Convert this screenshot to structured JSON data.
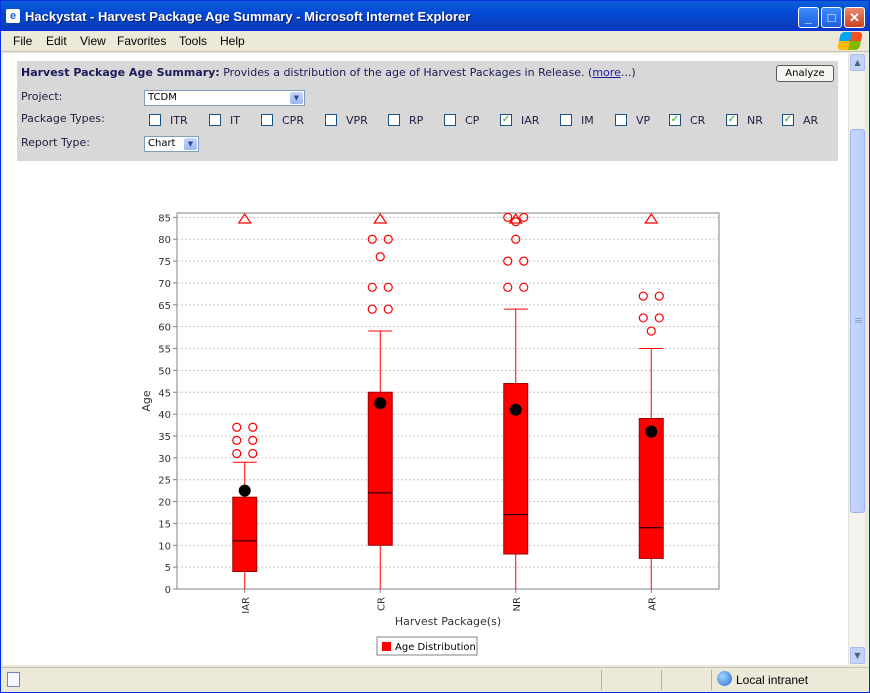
{
  "window": {
    "title": "Hackystat - Harvest Package Age Summary - Microsoft Internet Explorer",
    "buttons": {
      "minimize": "_",
      "maximize": "□",
      "close": "✕"
    }
  },
  "menubar": {
    "items": [
      "File",
      "Edit",
      "View",
      "Favorites",
      "Tools",
      "Help"
    ]
  },
  "form": {
    "heading_bold": "Harvest Package Age Summary:",
    "heading_text": "Provides a distribution of the age of Harvest Packages in Release. (",
    "more_link": "more",
    "heading_tail": "...)",
    "analyze_label": "Analyze",
    "project_label": "Project:",
    "project_value": "TCDM",
    "package_types_label": "Package Types:",
    "report_type_label": "Report Type:",
    "report_type_value": "Chart",
    "package_types": [
      {
        "label": "ITR",
        "checked": false
      },
      {
        "label": "IT",
        "checked": false
      },
      {
        "label": "CPR",
        "checked": false
      },
      {
        "label": "VPR",
        "checked": false
      },
      {
        "label": "RP",
        "checked": false
      },
      {
        "label": "CP",
        "checked": false
      },
      {
        "label": "IAR",
        "checked": true
      },
      {
        "label": "IM",
        "checked": false
      },
      {
        "label": "VP",
        "checked": false
      },
      {
        "label": "CR",
        "checked": true
      },
      {
        "label": "NR",
        "checked": true
      },
      {
        "label": "AR",
        "checked": true
      }
    ]
  },
  "chart_data": {
    "type": "boxplot",
    "xlabel": "Harvest Package(s)",
    "ylabel": "Age",
    "ylim": [
      0,
      86
    ],
    "yticks": [
      0,
      5,
      10,
      15,
      20,
      25,
      30,
      35,
      40,
      45,
      50,
      55,
      60,
      65,
      70,
      75,
      80,
      85
    ],
    "grid": true,
    "legend": {
      "label": "Age Distribution",
      "placement": "bottom-center"
    },
    "colors": {
      "box": "#ff0000",
      "mean": "#000000",
      "outlier": "#ff0000"
    },
    "categories": [
      "IAR",
      "CR",
      "NR",
      "AR"
    ],
    "boxes": [
      {
        "category": "IAR",
        "min": 0,
        "q1": 4,
        "median": 11,
        "q3": 21,
        "max": 29,
        "mean": 22.5,
        "outliers": [
          31,
          31,
          34,
          34,
          37,
          37
        ],
        "far_outlier": true
      },
      {
        "category": "CR",
        "min": 0,
        "q1": 10,
        "median": 22,
        "q3": 45,
        "max": 59,
        "mean": 42.5,
        "outliers": [
          64,
          64,
          69,
          69,
          76,
          80,
          80
        ],
        "far_outlier": true
      },
      {
        "category": "NR",
        "min": 0,
        "q1": 8,
        "median": 17,
        "q3": 47,
        "max": 64,
        "mean": 41,
        "outliers": [
          69,
          69,
          75,
          75,
          80,
          84,
          85,
          85
        ],
        "far_outlier": true
      },
      {
        "category": "AR",
        "min": 0,
        "q1": 7,
        "median": 14,
        "q3": 39,
        "max": 55,
        "mean": 36,
        "outliers": [
          59,
          62,
          62,
          67,
          67
        ],
        "far_outlier": true
      }
    ]
  },
  "statusbar": {
    "zone": "Local intranet"
  }
}
